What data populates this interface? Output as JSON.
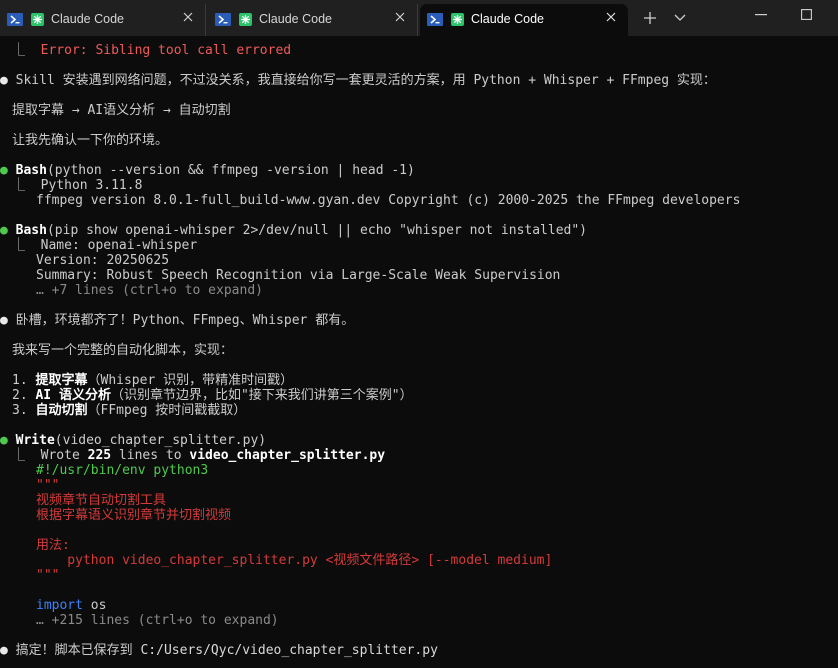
{
  "tabs": [
    {
      "title": "Claude Code",
      "active": false
    },
    {
      "title": "Claude Code",
      "active": false
    },
    {
      "title": "Claude Code",
      "active": true
    }
  ],
  "titlebar": {
    "new_tab": "+",
    "dropdown": "⌄"
  },
  "lines": {
    "l0": "Error: Sibling tool call errored",
    "l1": "Skill 安装遇到网络问题，不过没关系，我直接给你写一套更灵活的方案，用 Python + Whisper + FFmpeg 实现：",
    "l2": "提取字幕 → AI语义分析 → 自动切割",
    "l3": "让我先确认一下你的环境。",
    "bash1_cmd": "Bash",
    "bash1_args": "(python --version && ffmpeg -version | head -1)",
    "bash1_out1": "Python 3.11.8",
    "bash1_out2": "ffmpeg version 8.0.1-full_build-www.gyan.dev Copyright (c) 2000-2025 the FFmpeg developers",
    "bash2_cmd": "Bash",
    "bash2_args": "(pip show openai-whisper 2>/dev/null || echo \"whisper not installed\")",
    "bash2_out1": "Name: openai-whisper",
    "bash2_out2": "Version: 20250625",
    "bash2_out3": "Summary: Robust Speech Recognition via Large-Scale Weak Supervision",
    "bash2_more": "… +7 lines (ctrl+o to expand)",
    "l4": "卧槽，环境都齐了！Python、FFmpeg、Whisper 都有。",
    "l5": "我来写一个完整的自动化脚本，实现：",
    "item1_num": "1. ",
    "item1_bold": "提取字幕",
    "item1_rest": "（Whisper 识别，带精准时间戳）",
    "item2_num": "2. ",
    "item2_bold": "AI 语义分析",
    "item2_rest": "（识别章节边界，比如\"接下来我们讲第三个案例\"）",
    "item3_num": "3. ",
    "item3_bold": "自动切割",
    "item3_rest": "（FFmpeg 按时间戳截取）",
    "write_cmd": "Write",
    "write_args": "(video_chapter_splitter.py)",
    "wrote_pre": "Wrote ",
    "wrote_count": "225",
    "wrote_mid": " lines to ",
    "wrote_file": "video_chapter_splitter.py",
    "code1": "#!/usr/bin/env python3",
    "code2": "\"\"\"",
    "code3": "视频章节自动切割工具",
    "code4": "根据字幕语义识别章节并切割视频",
    "code5": "用法:",
    "code6": "    python video_chapter_splitter.py <视频文件路径> [--model medium]",
    "code7": "\"\"\"",
    "code8_kw": "import",
    "code8_rest": " os",
    "code_more": "… +215 lines (ctrl+o to expand)",
    "l6": "搞定！脚本已保存到 ",
    "l6_path": "C:/Users/Qyc/video_chapter_splitter.py"
  },
  "colors": {
    "background": "#0c0c0c",
    "tabbar": "#202020",
    "error": "#ee5a5a",
    "shebang": "#4ec94e",
    "string": "#d43a3a",
    "keyword": "#3b82f6",
    "dim": "#8a8a8a"
  },
  "icons": [
    "powershell-icon",
    "claude-code-icon",
    "close-icon",
    "new-tab-icon",
    "dropdown-icon",
    "minimize-icon",
    "maximize-icon"
  ]
}
